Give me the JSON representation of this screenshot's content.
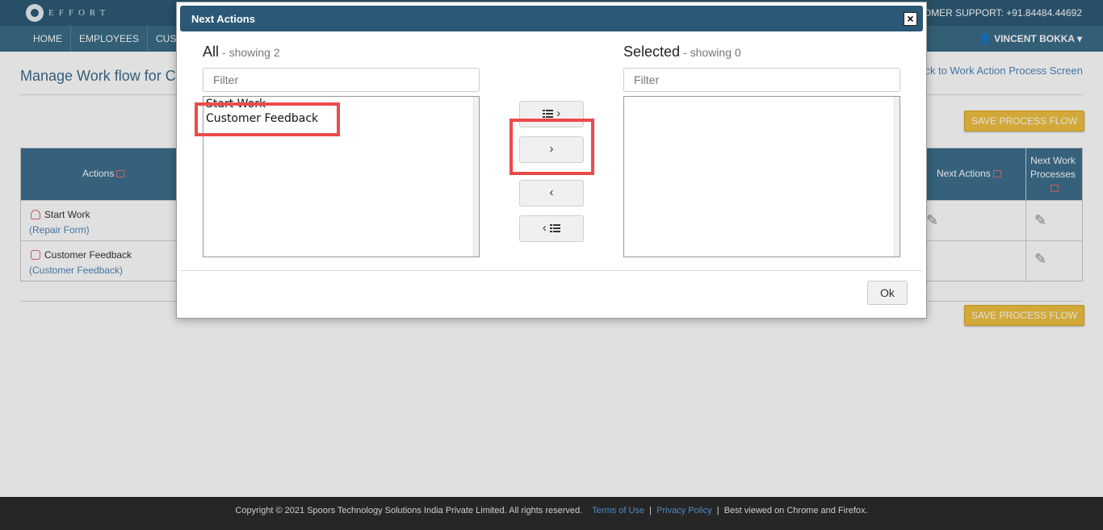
{
  "app": {
    "logo_text": "EFFORT",
    "support": "CUSTOMER SUPPORT: +91.84484.44692"
  },
  "nav": {
    "items": [
      "HOME",
      "EMPLOYEES",
      "CUS"
    ],
    "user": "VINCENT BOKKA"
  },
  "page": {
    "title": "Manage Work flow for C",
    "back_link": "ck to Work Action Process Screen",
    "save_label": "SAVE PROCESS FLOW"
  },
  "table": {
    "headers": {
      "actions": "Actions",
      "next_actions": "Next Actions",
      "next_work_processes": "Next Work Processes"
    },
    "rows": [
      {
        "name": "Start Work",
        "form": "(Repair Form)",
        "icon": "person-icon"
      },
      {
        "name": "Customer Feedback",
        "form": "(Customer Feedback)",
        "icon": "external-link-icon"
      }
    ]
  },
  "modal": {
    "title": "Next Actions",
    "close_label": "×",
    "left": {
      "heading": "All",
      "showing": "- showing 2",
      "filter_placeholder": "Filter",
      "options": [
        "Start Work",
        "Customer Feedback"
      ]
    },
    "right": {
      "heading": "Selected",
      "showing": "- showing 0",
      "filter_placeholder": "Filter",
      "options": []
    },
    "buttons": {
      "move_all": "›",
      "move_one": "›",
      "remove_one": "‹",
      "remove_all": "‹"
    },
    "ok_label": "Ok",
    "highlight_color": "#ec4a4a"
  },
  "footer": {
    "copyright": "Copyright © 2021 Spoors Technology Solutions India Private Limited. All rights reserved.",
    "terms": "Terms of Use",
    "privacy": "Privacy Policy",
    "best_viewed": "Best viewed on Chrome and Firefox."
  }
}
